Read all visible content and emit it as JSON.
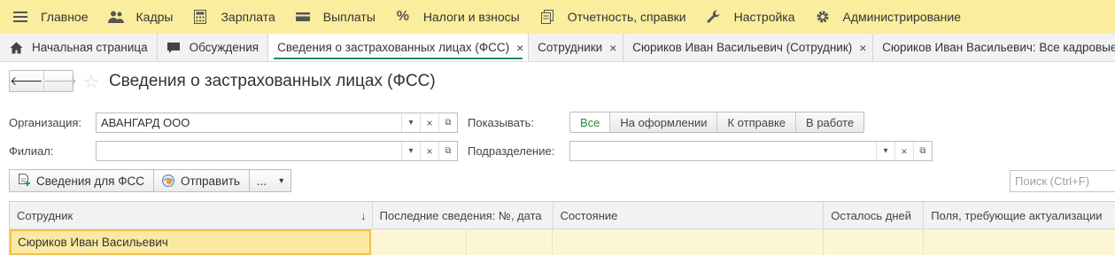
{
  "menu": [
    {
      "label": "Главное",
      "icon": "hamburger-icon"
    },
    {
      "label": "Кадры",
      "icon": "users-icon"
    },
    {
      "label": "Зарплата",
      "icon": "calculator-icon"
    },
    {
      "label": "Выплаты",
      "icon": "wallet-icon"
    },
    {
      "label": "Налоги и взносы",
      "icon": "percent-icon"
    },
    {
      "label": "Отчетность, справки",
      "icon": "documents-icon"
    },
    {
      "label": "Настройка",
      "icon": "wrench-icon"
    },
    {
      "label": "Администрирование",
      "icon": "gear-icon"
    }
  ],
  "tabs": [
    {
      "label": "Начальная страница",
      "icon": "home-icon"
    },
    {
      "label": "Обсуждения",
      "icon": "chat-icon"
    },
    {
      "label": "Сведения о застрахованных лицах (ФСС)",
      "close": "×"
    },
    {
      "label": "Сотрудники",
      "close": "×"
    },
    {
      "label": "Сюриков Иван Васильевич (Сотрудник)",
      "close": "×"
    },
    {
      "label": "Сюриков Иван Васильевич: Все кадровые"
    }
  ],
  "nav": {
    "back": "🡐",
    "forward": "🡒",
    "favorite": "☆"
  },
  "page": {
    "title": "Сведения о застрахованных лицах (ФСС)"
  },
  "filters": {
    "organization_label": "Организация:",
    "organization_value": "АВАНГАРД ООО",
    "branch_label": "Филиал:",
    "branch_value": "",
    "show_label": "Показывать:",
    "department_label": "Подразделение:",
    "department_value": "",
    "show_options": [
      "Все",
      "На оформлении",
      "К отправке",
      "В работе"
    ],
    "show_selected": "Все"
  },
  "field_buttons": {
    "dropdown": "▾",
    "clear": "×",
    "open": "⧉"
  },
  "toolbar": {
    "fss_button": "Сведения для ФСС",
    "send_button": "Отправить",
    "more_button": "...",
    "more_arrow": "▾",
    "search_placeholder": "Поиск (Ctrl+F)"
  },
  "table": {
    "columns": [
      "Сотрудник",
      "Последние сведения: №, дата",
      "Состояние",
      "Осталось дней",
      "Поля, требующие актуализации"
    ],
    "sort_indicator": "↓",
    "rows": [
      {
        "employee": "Сюриков Иван Васильевич",
        "last_info": "",
        "state": "",
        "days_left": "",
        "fields": ""
      }
    ]
  },
  "colors": {
    "menubar_bg": "#fbed9e",
    "accent_green": "#1c8f5a",
    "selected_row_bg": "#fdf6d6",
    "focused_cell_border": "#f2c04f"
  }
}
